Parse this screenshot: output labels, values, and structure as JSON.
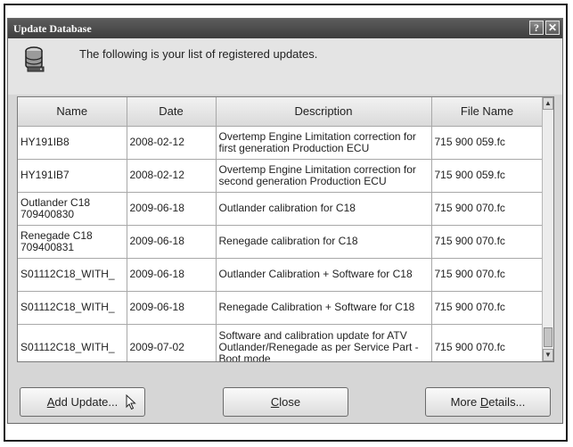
{
  "window": {
    "title": "Update Database",
    "help_glyph": "?",
    "close_glyph": "✕"
  },
  "header": {
    "message": "The following is your list of registered updates."
  },
  "table": {
    "columns": [
      "Name",
      "Date",
      "Description",
      "File Name"
    ],
    "rows": [
      {
        "name": "HY191IB8",
        "date": "2008-02-12",
        "description": "Overtemp Engine Limitation correction for first generation Production ECU",
        "file": "715 900 059.fc"
      },
      {
        "name": "HY191IB7",
        "date": "2008-02-12",
        "description": "Overtemp Engine Limitation correction for second generation Production ECU",
        "file": "715 900 059.fc"
      },
      {
        "name": "Outlander C18 709400830",
        "date": "2009-06-18",
        "description": "Outlander calibration for C18",
        "file": "715 900 070.fc"
      },
      {
        "name": "Renegade C18 709400831",
        "date": "2009-06-18",
        "description": "Renegade calibration for C18",
        "file": "715 900 070.fc"
      },
      {
        "name": "S01112C18_WITH_",
        "date": "2009-06-18",
        "description": "Outlander Calibration + Software for C18",
        "file": "715 900 070.fc"
      },
      {
        "name": "S01112C18_WITH_",
        "date": "2009-06-18",
        "description": "Renegade Calibration + Software for C18",
        "file": "715 900 070.fc"
      },
      {
        "name": "S01112C18_WITH_",
        "date": "2009-07-02",
        "description": "Software and calibration update for ATV Outlander/Renegade as per Service Part - Boot mode",
        "file": "715 900 070.fc"
      }
    ]
  },
  "scrollbar": {
    "up_glyph": "▲",
    "down_glyph": "▼"
  },
  "buttons": {
    "add_accel": "A",
    "add_rest": "dd Update...",
    "close_accel": "C",
    "close_rest": "lose",
    "details_before": "More ",
    "details_accel": "D",
    "details_after": "etails..."
  },
  "icons": {
    "database": "database-icon",
    "cursor": "mouse-pointer-icon"
  }
}
